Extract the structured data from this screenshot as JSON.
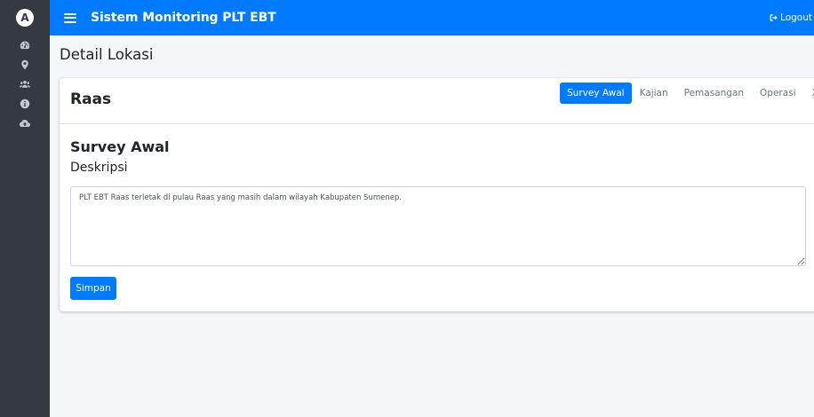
{
  "brand": {
    "logo_letter": "A"
  },
  "sidebar": {
    "items": [
      {
        "icon": "dashboard-gauge-icon"
      },
      {
        "icon": "map-marker-icon"
      },
      {
        "icon": "users-icon"
      },
      {
        "icon": "info-circle-icon"
      },
      {
        "icon": "cloud-upload-icon"
      }
    ]
  },
  "header": {
    "title": "Sistem Monitoring PLT EBT",
    "logout_label": "Logout"
  },
  "page": {
    "title": "Detail Lokasi"
  },
  "card": {
    "title": "Raas",
    "tabs": [
      {
        "label": "Survey Awal",
        "active": true
      },
      {
        "label": "Kajian",
        "active": false
      },
      {
        "label": "Pemasangan",
        "active": false
      },
      {
        "label": "Operasi",
        "active": false
      },
      {
        "label": "X",
        "active": false
      }
    ]
  },
  "section": {
    "title": "Survey Awal",
    "field_label": "Deskripsi",
    "description": "PLT EBT Raas terletak di pulau Raas yang masih dalam wilayah Kabupaten Sumenep.",
    "save_label": "Simpan"
  },
  "colors": {
    "primary": "#007bff",
    "sidebar_bg": "#343a40",
    "page_bg": "#f4f6f9"
  }
}
